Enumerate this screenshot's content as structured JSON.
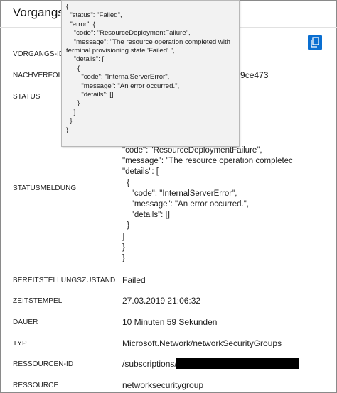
{
  "header": {
    "title": "Vorgangsd"
  },
  "fields": {
    "vorgangs_id": {
      "label": "VORGANGS-ID"
    },
    "nachverfolgung": {
      "label": "NACHVERFOLG",
      "value": "2179ce473"
    },
    "status": {
      "label": "STATUS"
    },
    "statusmeldung": {
      "label": "STATUSMELDUNG",
      "json_text": "\"code\": \"ResourceDeploymentFailure\",\n\"message\": \"The resource operation completec\n\"details\": [\n  {\n    \"code\": \"InternalServerError\",\n    \"message\": \"An error occurred.\",\n    \"details\": []\n  }\n]\n}\n}"
    },
    "bereitstellungszustand": {
      "label": "BEREITSTELLUNGSZUSTAND",
      "value": "Failed"
    },
    "zeitstempel": {
      "label": "ZEITSTEMPEL",
      "value": "27.03.2019 21:06:32"
    },
    "dauer": {
      "label": "DAUER",
      "value": "10 Minuten 59 Sekunden"
    },
    "typ": {
      "label": "TYP",
      "value": "Microsoft.Network/networkSecurityGroups"
    },
    "ressourcen_id": {
      "label": "RESSOURCEN-ID",
      "value": "/subscriptions/"
    },
    "ressource": {
      "label": "RESSOURCE",
      "value": "networksecuritygroup"
    }
  },
  "tooltip": {
    "json_text": "{\n  \"status\": \"Failed\",\n  \"error\": {\n    \"code\": \"ResourceDeploymentFailure\",\n    \"message\": \"The resource operation completed with\nterminal provisioning state 'Failed'.\",\n    \"details\": [\n      {\n        \"code\": \"InternalServerError\",\n        \"message\": \"An error occurred.\",\n        \"details\": []\n      }\n    ]\n  }\n}"
  },
  "icons": {
    "copy": "copy-icon"
  },
  "colors": {
    "accent": "#0a6fd1",
    "redaction": "#000000",
    "tooltip_bg": "#f2f2f2"
  }
}
